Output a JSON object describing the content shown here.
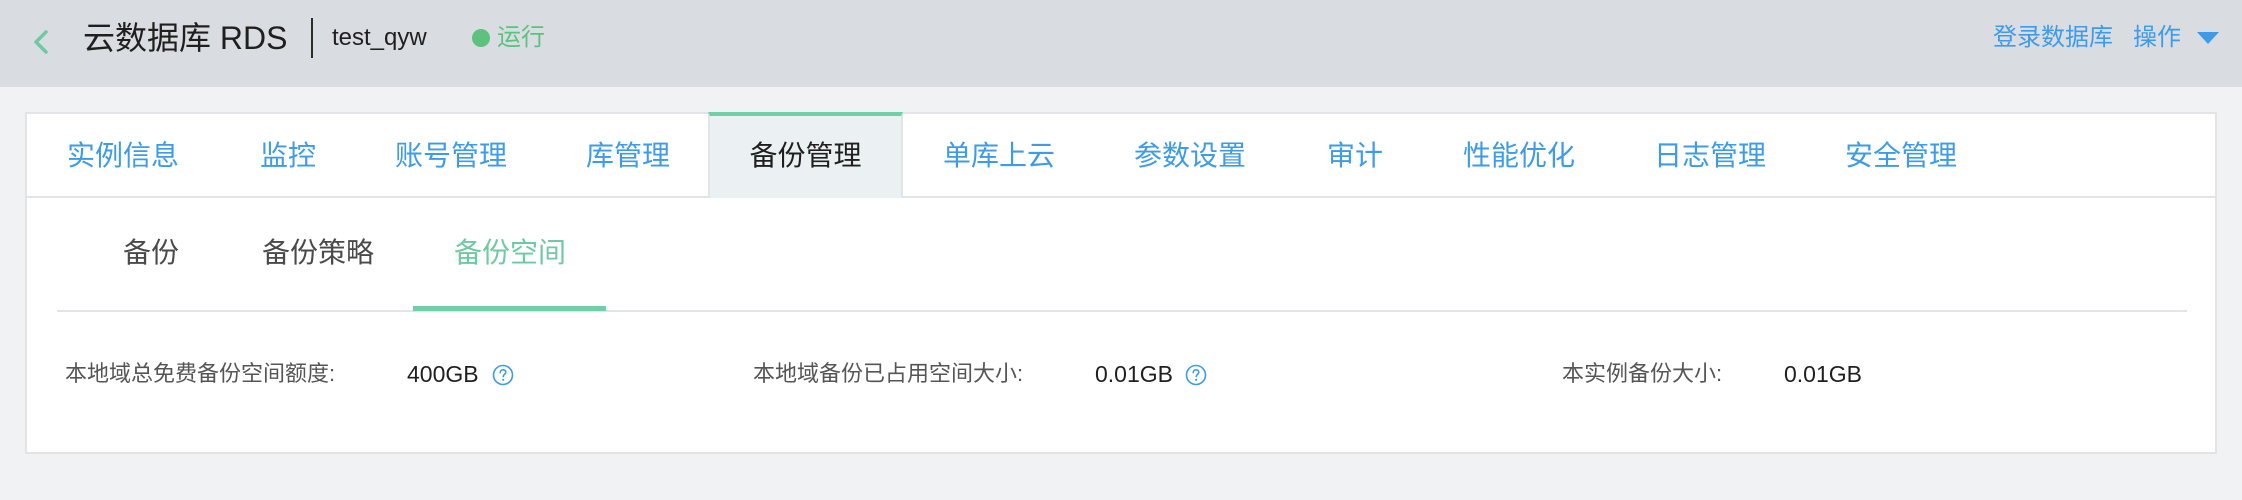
{
  "header": {
    "title": "云数据库 RDS",
    "instance_name": "test_qyw",
    "status": "运行",
    "login_link": "登录数据库",
    "operations_label": "操作"
  },
  "tabs": [
    {
      "label": "实例信息"
    },
    {
      "label": "监控"
    },
    {
      "label": "账号管理"
    },
    {
      "label": "库管理"
    },
    {
      "label": "备份管理",
      "active": true
    },
    {
      "label": "单库上云"
    },
    {
      "label": "参数设置"
    },
    {
      "label": "审计"
    },
    {
      "label": "性能优化"
    },
    {
      "label": "日志管理"
    },
    {
      "label": "安全管理"
    }
  ],
  "subtabs": [
    {
      "label": "备份"
    },
    {
      "label": "备份策略"
    },
    {
      "label": "备份空间",
      "active": true
    }
  ],
  "info": {
    "free_quota_label": "本地域总免费备份空间额度:",
    "free_quota_value": "400GB",
    "used_space_label": "本地域备份已占用空间大小:",
    "used_space_value": "0.01GB",
    "instance_backup_label": "本实例备份大小:",
    "instance_backup_value": "0.01GB"
  },
  "colors": {
    "accent_blue": "#3d9be9",
    "status_green": "#5ec27f",
    "active_tab_indicator": "#6fd0a8"
  },
  "icons": {
    "back": "chevron-left-icon",
    "dropdown": "caret-down-icon",
    "help": "question-circle-icon"
  }
}
